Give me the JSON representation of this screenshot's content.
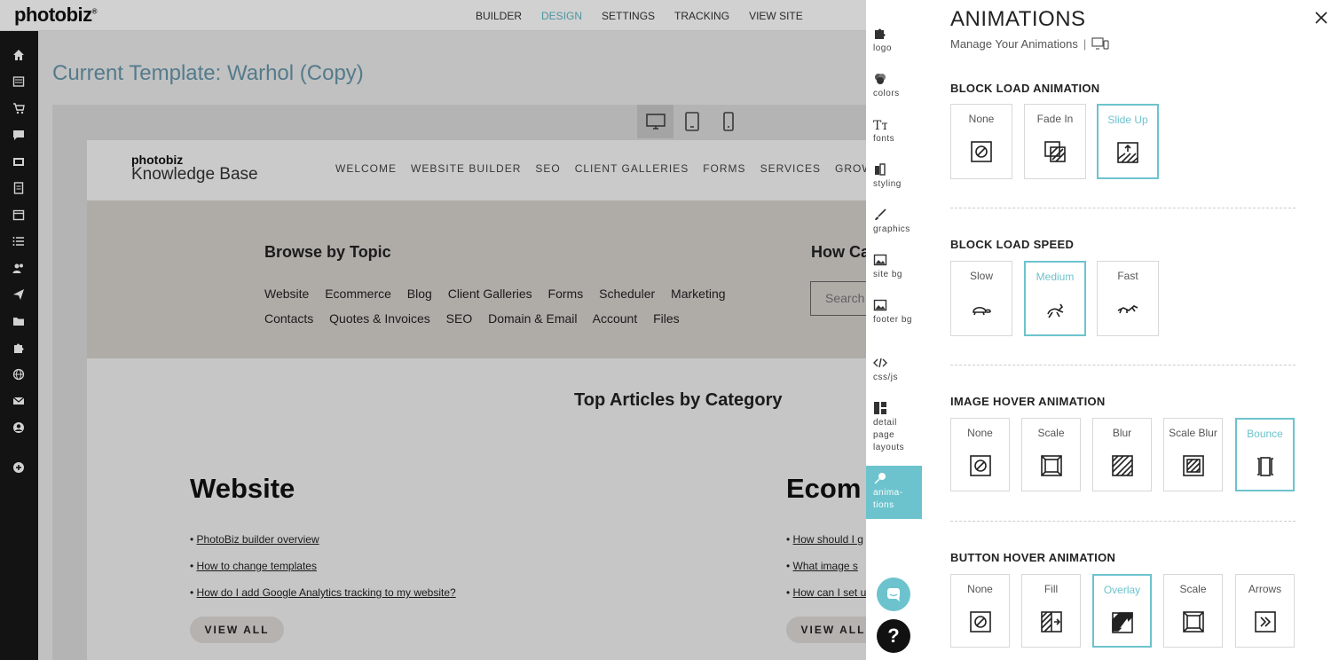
{
  "brand": {
    "logo": "photobiz",
    "accent": "#6cc3cd"
  },
  "topnav": [
    {
      "label": "BUILDER",
      "active": false
    },
    {
      "label": "DESIGN",
      "active": true
    },
    {
      "label": "SETTINGS",
      "active": false
    },
    {
      "label": "TRACKING",
      "active": false
    },
    {
      "label": "VIEW SITE",
      "active": false
    }
  ],
  "sidebar_icons": [
    "home-icon",
    "pages-icon",
    "cart-icon",
    "chat-icon",
    "gallery-icon",
    "document-icon",
    "calendar-icon",
    "list-icon",
    "users-icon",
    "send-icon",
    "folder-icon",
    "puzzle-icon",
    "globe-icon",
    "mail-icon",
    "account-icon",
    "add-icon"
  ],
  "main": {
    "title": "Current Template: Warhol (Copy)"
  },
  "site": {
    "logo_line1": "photobiz",
    "logo_line2": "Knowledge Base",
    "nav": [
      "WELCOME",
      "WEBSITE BUILDER",
      "SEO",
      "CLIENT GALLERIES",
      "FORMS",
      "SERVICES",
      "GROWTH H"
    ],
    "browse_title": "Browse by Topic",
    "topics": [
      "Website",
      "Ecommerce",
      "Blog",
      "Client Galleries",
      "Forms",
      "Scheduler",
      "Marketing",
      "Contacts",
      "Quotes & Invoices",
      "SEO",
      "Domain & Email",
      "Account",
      "Files"
    ],
    "how_title": "How Ca",
    "search_placeholder": "Search",
    "top_articles": "Top Articles by Category",
    "categories": [
      {
        "title": "Website",
        "articles": [
          "PhotoBiz builder overview",
          "How to change templates",
          "How do I add Google Analytics tracking to my website?"
        ],
        "button": "VIEW ALL"
      },
      {
        "title": "Ecom",
        "articles": [
          "How should I g",
          "What image s",
          "How can I set u"
        ],
        "button": "VIEW ALL"
      }
    ]
  },
  "tabs": [
    {
      "label": "logo",
      "icon": "puzzle-icon",
      "active": false
    },
    {
      "label": "colors",
      "icon": "colors-icon",
      "active": false
    },
    {
      "label": "fonts",
      "icon": "fonts-icon",
      "active": false
    },
    {
      "label": "styling",
      "icon": "styling-icon",
      "active": false
    },
    {
      "label": "graphics",
      "icon": "brush-icon",
      "active": false
    },
    {
      "label": "site bg",
      "icon": "image-icon",
      "active": false
    },
    {
      "label": "footer bg",
      "icon": "image-icon",
      "active": false
    },
    {
      "label": "css/js",
      "icon": "code-icon",
      "active": false
    },
    {
      "label": "detail page layouts",
      "icon": "layout-icon",
      "active": false
    },
    {
      "label": "anima-tions",
      "icon": "animations-icon",
      "active": true
    }
  ],
  "panel": {
    "title": "ANIMATIONS",
    "subtitle": "Manage Your Animations",
    "sections": [
      {
        "title": "BLOCK LOAD ANIMATION",
        "options": [
          {
            "label": "None",
            "icon": "none-icon",
            "selected": false
          },
          {
            "label": "Fade In",
            "icon": "fade-in-icon",
            "selected": false
          },
          {
            "label": "Slide Up",
            "icon": "slide-up-icon",
            "selected": true
          }
        ]
      },
      {
        "title": "BLOCK LOAD SPEED",
        "options": [
          {
            "label": "Slow",
            "icon": "turtle-icon",
            "selected": false
          },
          {
            "label": "Medium",
            "icon": "rabbit-icon",
            "selected": true
          },
          {
            "label": "Fast",
            "icon": "fast-icon",
            "selected": false
          }
        ]
      },
      {
        "title": "IMAGE HOVER ANIMATION",
        "options": [
          {
            "label": "None",
            "icon": "none-icon",
            "selected": false
          },
          {
            "label": "Scale",
            "icon": "scale-icon",
            "selected": false
          },
          {
            "label": "Blur",
            "icon": "blur-icon",
            "selected": false
          },
          {
            "label": "Scale Blur",
            "icon": "scale-blur-icon",
            "selected": false
          },
          {
            "label": "Bounce",
            "icon": "bounce-icon",
            "selected": true
          }
        ]
      },
      {
        "title": "BUTTON HOVER ANIMATION",
        "options": [
          {
            "label": "None",
            "icon": "none-icon",
            "selected": false
          },
          {
            "label": "Fill",
            "icon": "fill-icon",
            "selected": false
          },
          {
            "label": "Overlay",
            "icon": "overlay-icon",
            "selected": true
          },
          {
            "label": "Scale",
            "icon": "scale-icon",
            "selected": false
          },
          {
            "label": "Arrows",
            "icon": "arrows-icon",
            "selected": false
          }
        ]
      }
    ]
  },
  "help_label": "?"
}
